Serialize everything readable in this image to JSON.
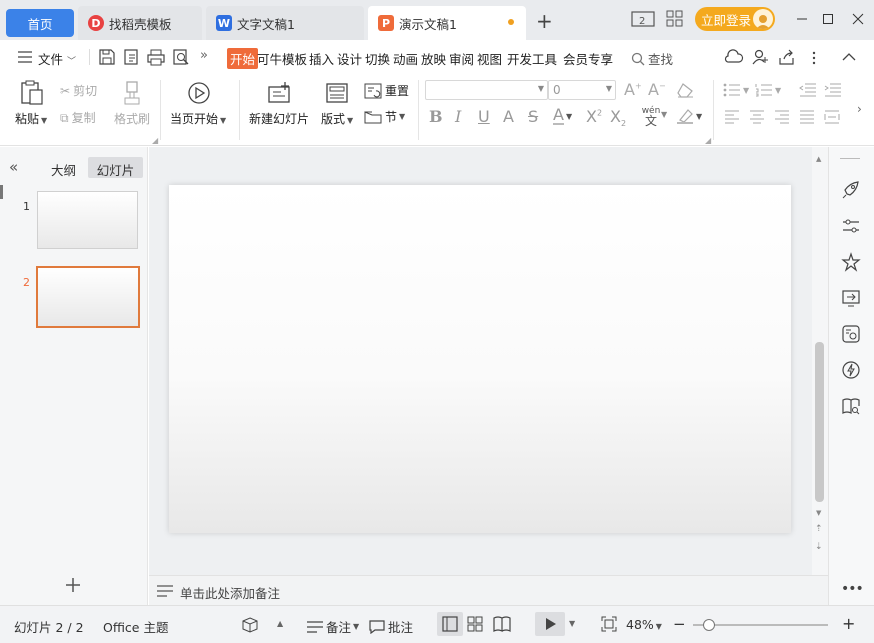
{
  "tabs": {
    "home": "首页",
    "template": "找稻壳模板",
    "doc": "文字文稿1",
    "active": "演示文稿1",
    "add": "+"
  },
  "titlebar": {
    "login": "立即登录"
  },
  "menu": {
    "file": "文件",
    "items": [
      "开始",
      "可牛模板",
      "插入",
      "设计",
      "切换",
      "动画",
      "放映",
      "审阅",
      "视图",
      "开发工具",
      "会员专享"
    ],
    "search": "查找"
  },
  "ribbon": {
    "paste": "粘贴",
    "cut": "剪切",
    "copy": "复制",
    "format_painter": "格式刷",
    "from_start": "当页开始",
    "new_slide": "新建幻灯片",
    "layout": "版式",
    "reset": "重置",
    "section": "节",
    "font_size": "0",
    "wen": "wén",
    "zi": "文"
  },
  "left_panel": {
    "outline": "大纲",
    "slides": "幻灯片",
    "thumbs": [
      "1",
      "2"
    ]
  },
  "notes": {
    "placeholder": "单击此处添加备注"
  },
  "status": {
    "slide_count": "幻灯片 2 / 2",
    "theme": "Office 主题",
    "notes": "备注",
    "comments": "批注",
    "zoom": "48%",
    "zoom_fraction": 0.48
  },
  "colors": {
    "accent": "#ef6b3a",
    "home_tab": "#3b82e8",
    "login": "#f4a91e"
  }
}
